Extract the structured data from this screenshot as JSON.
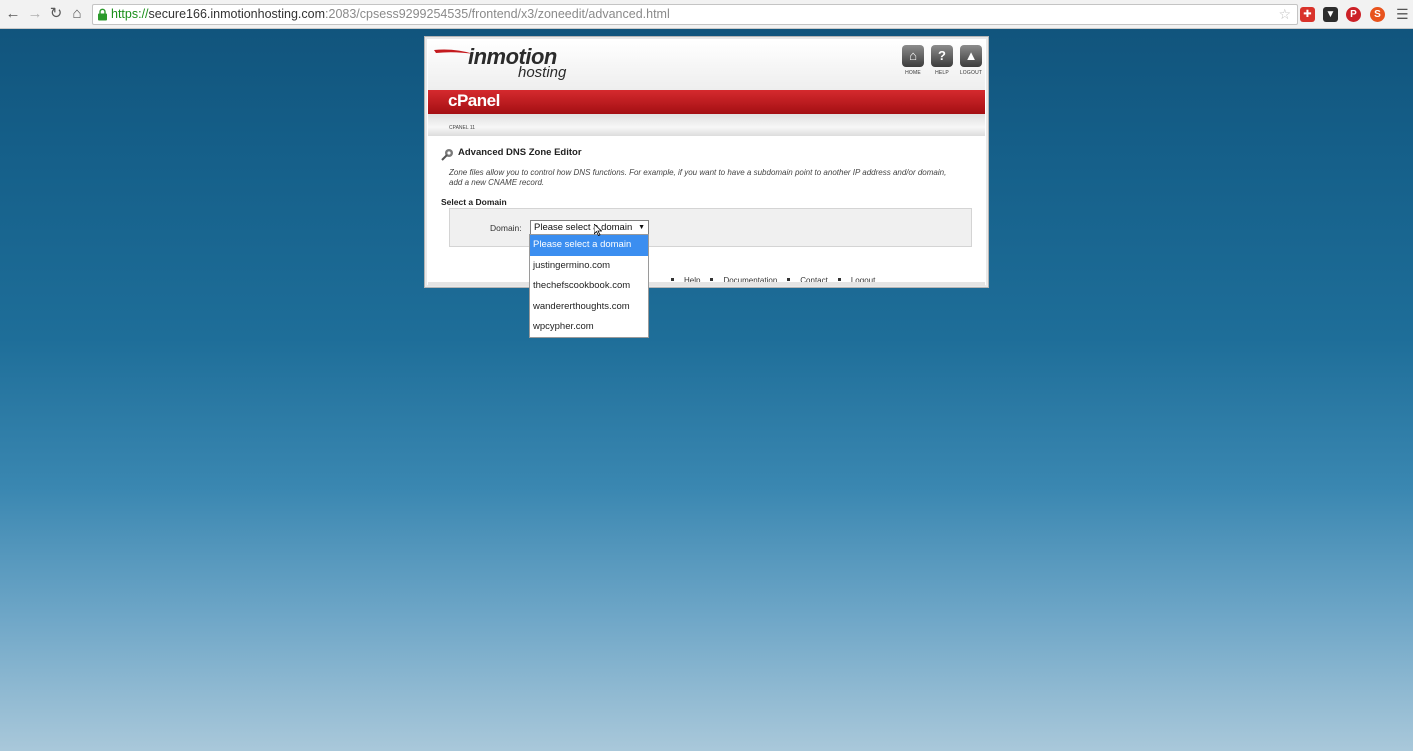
{
  "browser": {
    "url_scheme": "https://",
    "url_host": "secure166.inmotionhosting.com",
    "url_path": ":2083/cpsess9299254535/frontend/x3/zoneedit/advanced.html"
  },
  "header": {
    "logo_main": "inmotion",
    "logo_sub": "hosting",
    "buttons": [
      {
        "label": "HOME"
      },
      {
        "label": "HELP"
      },
      {
        "label": "LOGOUT"
      }
    ]
  },
  "app": {
    "title": "cPanel",
    "version": "CPANEL 11"
  },
  "page": {
    "title": "Advanced DNS Zone Editor",
    "intro": "Zone files allow you to control how DNS functions. For example, if you want to have a subdomain point to another IP address and/or domain, add a new CNAME record.",
    "section_title": "Select a Domain",
    "domain_label": "Domain:",
    "select_value": "Please select a domain",
    "options": [
      "Please select a domain",
      "justingermino.com",
      "thechefscookbook.com",
      "wandererthoughts.com",
      "wpcypher.com"
    ]
  },
  "footer": {
    "links": [
      "Help",
      "Documentation",
      "Contact",
      "Logout"
    ]
  },
  "colors": {
    "accent_red": "#c41a1e",
    "selected_option": "#3b8ef0"
  }
}
